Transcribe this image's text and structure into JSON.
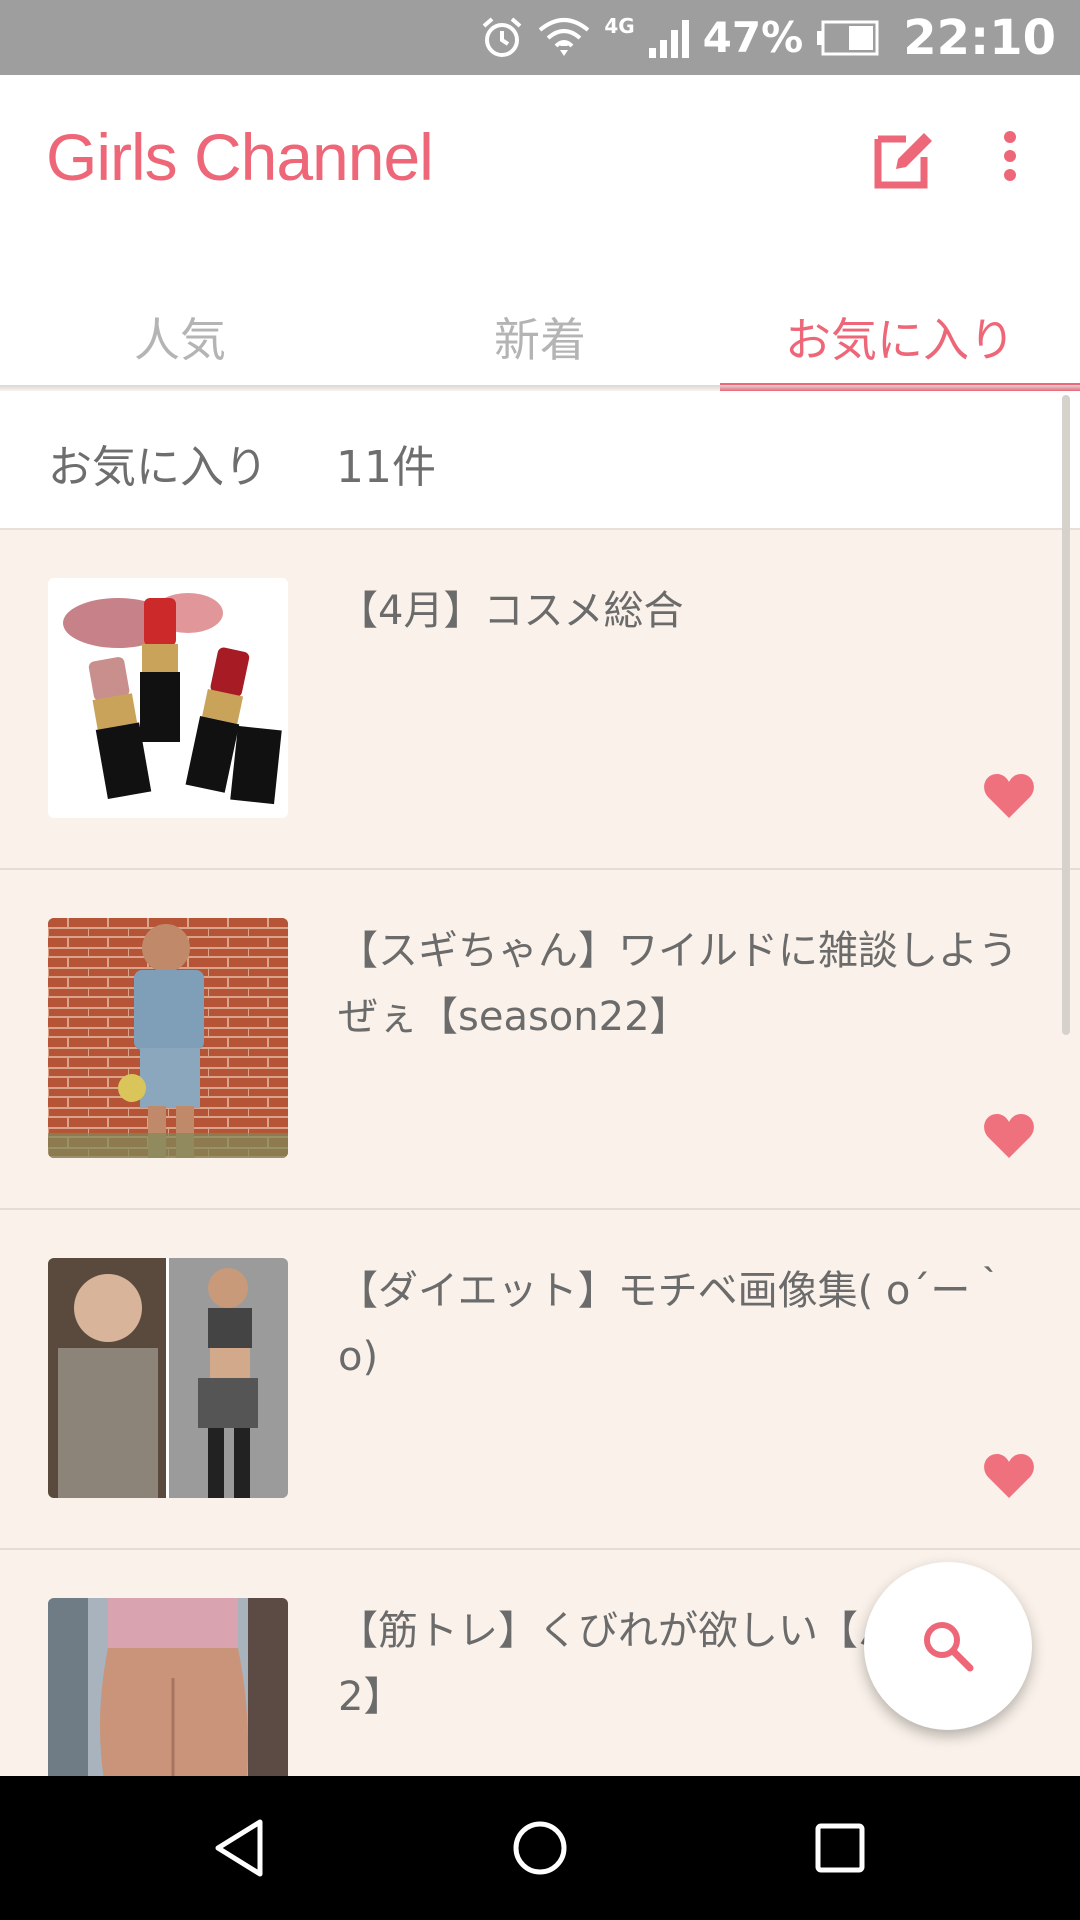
{
  "status_bar": {
    "network": "4G",
    "battery": "47%",
    "time": "22:10",
    "icons": [
      "alarm-icon",
      "wifi-icon",
      "signal-icon",
      "battery-icon"
    ]
  },
  "app": {
    "logo": "Girls Channel",
    "accent_color": "#ee6778",
    "actions": [
      "edit-icon",
      "more-icon"
    ]
  },
  "tabs": [
    {
      "label": "人気",
      "active": false
    },
    {
      "label": "新着",
      "active": false
    },
    {
      "label": "お気に入り",
      "active": true
    }
  ],
  "favorites_header": {
    "label": "お気に入り",
    "count": "11件"
  },
  "items": [
    {
      "title": "【4月】コスメ総合",
      "favorited": true
    },
    {
      "title": "【スギちゃん】ワイルドに雑談しようぜぇ【season22】",
      "favorited": true
    },
    {
      "title": "【ダイエット】モチベ画像集( o´ー｀o)",
      "favorited": true
    },
    {
      "title": "【筋トレ】くびれが欲しい【パート2】",
      "favorited": true
    }
  ],
  "fab": {
    "icon": "search-icon"
  },
  "nav_bar": [
    "back-icon",
    "home-icon",
    "recents-icon"
  ]
}
